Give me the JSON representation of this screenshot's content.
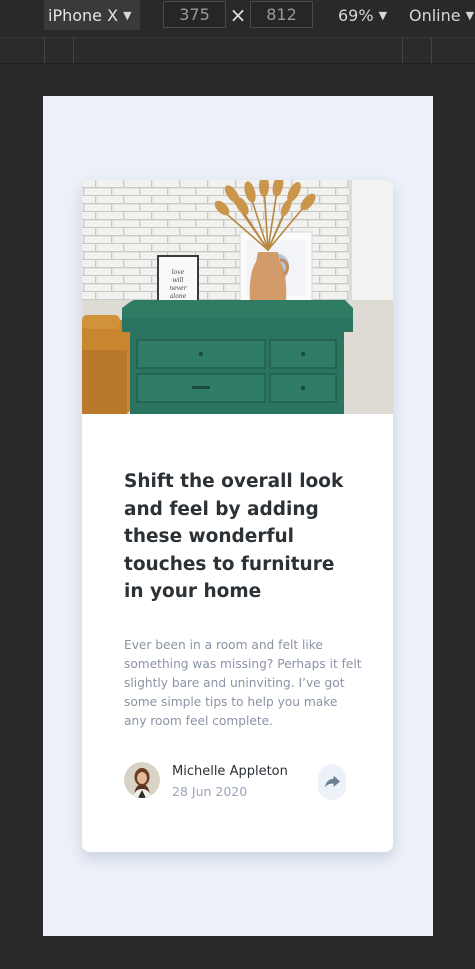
{
  "devtools": {
    "device": "iPhone X",
    "width": "375",
    "height": "812",
    "dimension_separator": "×",
    "zoom": "69%",
    "throttling": "Online",
    "caret_icon": "caret-down-icon"
  },
  "card": {
    "title": "Shift the overall look and feel by adding these wonderful touches to furniture in your home",
    "description": "Ever been in a room and felt like something was missing? Perhaps it felt slightly bare and uninviting. I’ve got some simple tips to help you make any room feel complete.",
    "author": {
      "name": "Michelle Appleton",
      "date": "28 Jun 2020"
    },
    "share_icon": "share-arrow-icon",
    "frame_text": "love will never alone"
  },
  "colors": {
    "page_bg": "#ecf0f8",
    "title": "#2c3136",
    "body_text": "#8a94a5",
    "date_text": "#9aa5b8",
    "share_bg": "#ecf2f8",
    "share_icon": "#6e8098"
  }
}
